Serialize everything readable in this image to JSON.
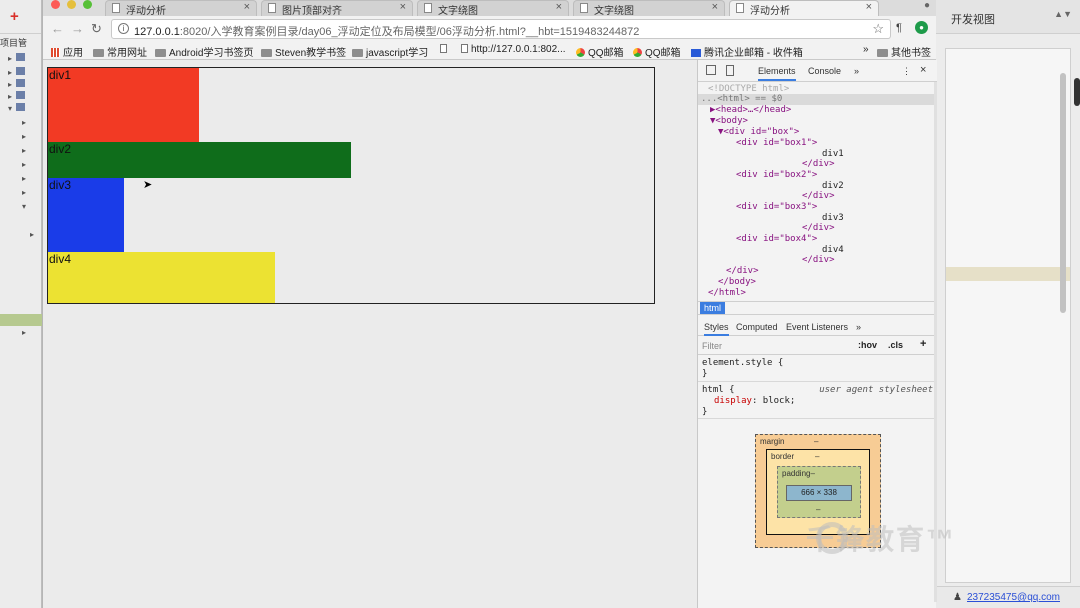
{
  "browser": {
    "tabs": [
      {
        "label": "浮动分析",
        "active": false
      },
      {
        "label": "图片顶部对齐",
        "active": false
      },
      {
        "label": "文字绕图",
        "active": false
      },
      {
        "label": "文字绕图",
        "active": false
      },
      {
        "label": "浮动分析",
        "active": true
      }
    ],
    "url_host": "127.0.0.1",
    "url_rest": ":8020/入学教育案例目录/day06_浮动定位及布局模型/06浮动分析.html?__hbt=1519483244872",
    "bookmarks": [
      {
        "label": "应用",
        "icon": "apps-grid-icon"
      },
      {
        "label": "常用网址",
        "icon": "folder-icon"
      },
      {
        "label": "Android学习书签页",
        "icon": "folder-icon"
      },
      {
        "label": "Steven教学书签",
        "icon": "folder-icon"
      },
      {
        "label": "javascript学习",
        "icon": "folder-icon"
      },
      {
        "label": "",
        "icon": "page-icon"
      },
      {
        "label": "http://127.0.0.1:802...",
        "icon": "page-icon"
      },
      {
        "label": "QQ邮箱",
        "icon": "qq-icon"
      },
      {
        "label": "QQ邮箱",
        "icon": "qq-icon"
      },
      {
        "label": "腾讯企业邮箱 - 收件箱",
        "icon": "mail-icon"
      }
    ],
    "bookmarks_more": "»",
    "other_bookmarks": "其他书签"
  },
  "page": {
    "boxes": [
      {
        "label": "div1",
        "color": "#f23a24"
      },
      {
        "label": "div2",
        "color": "#0f6d1b"
      },
      {
        "label": "div3",
        "color": "#1a3ce8"
      },
      {
        "label": "div4",
        "color": "#ece232"
      }
    ]
  },
  "devtools": {
    "tabs": [
      "Elements",
      "Console"
    ],
    "tabs_more": "»",
    "dom_lines": {
      "doctype": "<!DOCTYPE html>",
      "html_open": "...<html> == $0",
      "head": "▶<head>…</head>",
      "body_open": "▼<body>",
      "box_open": "▼<div id=\"box\">",
      "box1_open": "<div id=\"box1\">",
      "box1_text": "div1",
      "box1_close": "</div>",
      "box2_open": "<div id=\"box2\">",
      "box2_text": "div2",
      "box2_close": "</div>",
      "box3_open": "<div id=\"box3\">",
      "box3_text": "div3",
      "box3_close": "</div>",
      "box4_open": "<div id=\"box4\">",
      "box4_text": "div4",
      "box4_close": "</div>",
      "box_close": "</div>",
      "body_close": "</body>",
      "html_close": "</html>"
    },
    "breadcrumb": "html",
    "styles_tabs": [
      "Styles",
      "Computed",
      "Event Listeners"
    ],
    "styles_more": "»",
    "filter_placeholder": "Filter",
    "filter_hov": ":hov",
    "filter_cls": ".cls",
    "filter_add": "+",
    "rules": [
      {
        "selector": "element.style {",
        "decl": "",
        "close": "}",
        "source": ""
      },
      {
        "selector": "html {",
        "decl_prop": "display",
        "decl_val": "block;",
        "close": "}",
        "source": "user agent stylesheet"
      }
    ],
    "box_model": {
      "margin": "margin",
      "margin_top": "–",
      "border": "border",
      "border_top": "–",
      "padding": "padding–",
      "content": "666 × 338",
      "padding_bottom": "–"
    }
  },
  "watermark": "千锋教育™",
  "ide": {
    "left_label": "项目管",
    "view_title": "开发视图",
    "footer_email": "237235475@qq.com"
  }
}
